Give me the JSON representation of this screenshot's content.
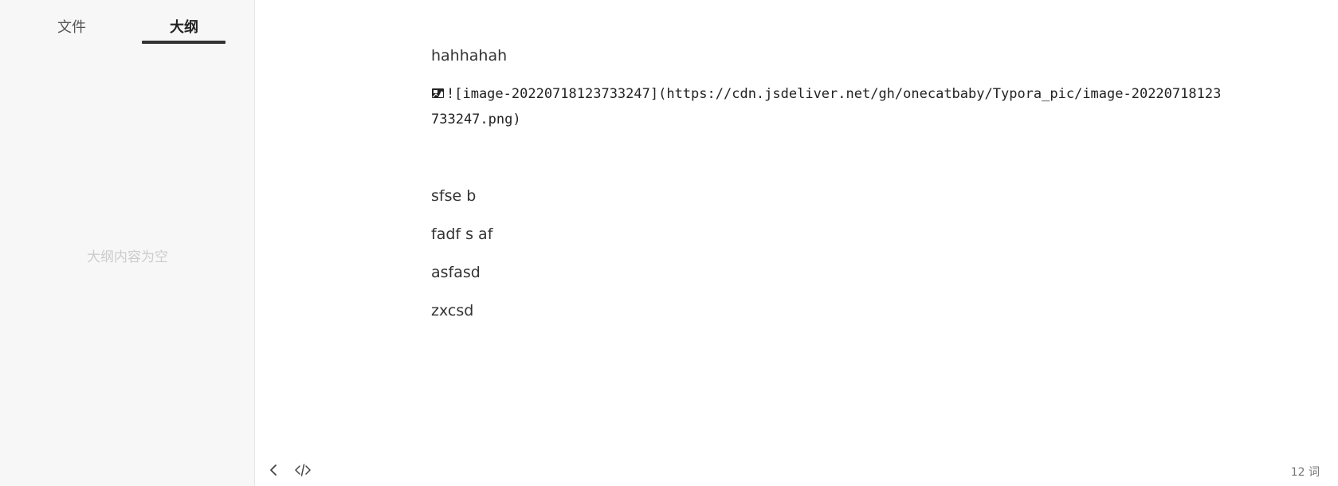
{
  "sidebar": {
    "tabs": [
      {
        "label": "文件",
        "active": false
      },
      {
        "label": "大纲",
        "active": true
      }
    ],
    "outline_empty_text": "大纲内容为空"
  },
  "editor": {
    "paragraphs": [
      "hahhahah",
      "sfse b",
      "fadf s af",
      "asfasd",
      "zxcsd"
    ],
    "image_markdown": "![image-20220718123733247](https://cdn.jsdeliver.net/gh/onecatbaby/Typora_pic/image-20220718123733247.png)",
    "image_icon": "broken-image-icon"
  },
  "footer": {
    "back_icon": "chevron-left-icon",
    "source_icon": "code-icon",
    "word_count": "12 词"
  },
  "colors": {
    "sidebar_bg": "#f7f7f7",
    "active_tab_underline": "#333333",
    "text": "#333333"
  }
}
